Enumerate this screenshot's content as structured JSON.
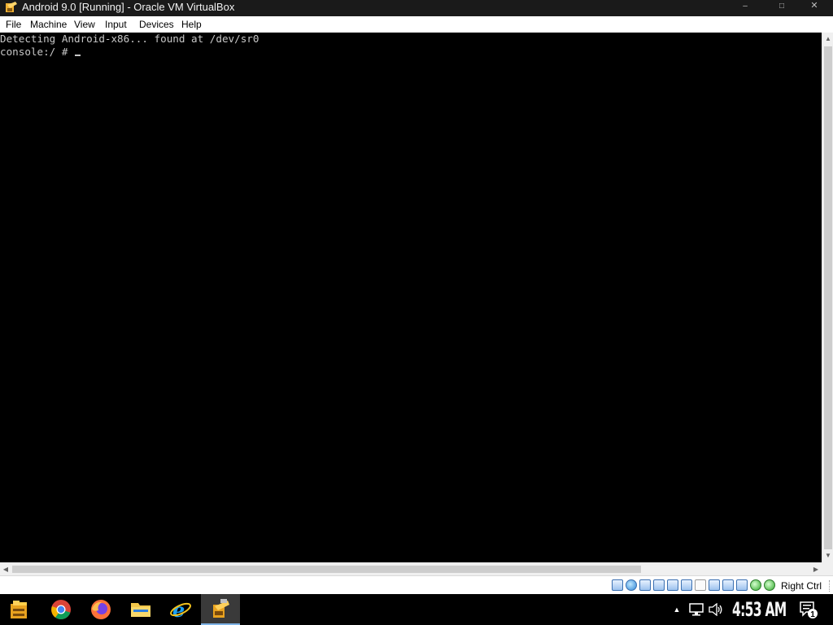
{
  "window": {
    "title": "Android 9.0 [Running] - Oracle VM VirtualBox",
    "icon": "virtualbox-logo-icon",
    "controls": {
      "minimize": "–",
      "maximize": "□",
      "close": "✕"
    }
  },
  "menubar": {
    "items": [
      {
        "label": "File"
      },
      {
        "label": "Machine"
      },
      {
        "label": "View"
      },
      {
        "label": "Input"
      },
      {
        "label": "Devices"
      },
      {
        "label": "Help"
      }
    ]
  },
  "console": {
    "lines": [
      "Detecting Android-x86... found at /dev/sr0",
      "console:/ # "
    ],
    "text_color": "#c7c7c7",
    "background": "#000000"
  },
  "statusbar": {
    "icons": [
      "hard-disk-icon",
      "optical-drive-icon",
      "audio-icon",
      "network-icon",
      "usb-icon",
      "shared-folders-icon",
      "display-icon",
      "video-capture-icon",
      "recording-icon",
      "cpu-icon",
      "mouse-integration-icon",
      "vm-state-icon"
    ],
    "host_key": "Right Ctrl"
  },
  "taskbar": {
    "apps": [
      {
        "name": "start-button",
        "icon": "start-icon"
      },
      {
        "name": "chrome",
        "icon": "chrome-icon"
      },
      {
        "name": "firefox",
        "icon": "firefox-icon"
      },
      {
        "name": "file-explorer",
        "icon": "folder-icon"
      },
      {
        "name": "internet-explorer",
        "icon": "internet-explorer-icon"
      },
      {
        "name": "virtualbox",
        "icon": "virtualbox-icon",
        "active": true
      }
    ],
    "tray": {
      "overflow": "▲",
      "network_icon": "network-icon",
      "volume_icon": "volume-icon",
      "time": "4:53 AM",
      "notifications_count": "1"
    }
  }
}
